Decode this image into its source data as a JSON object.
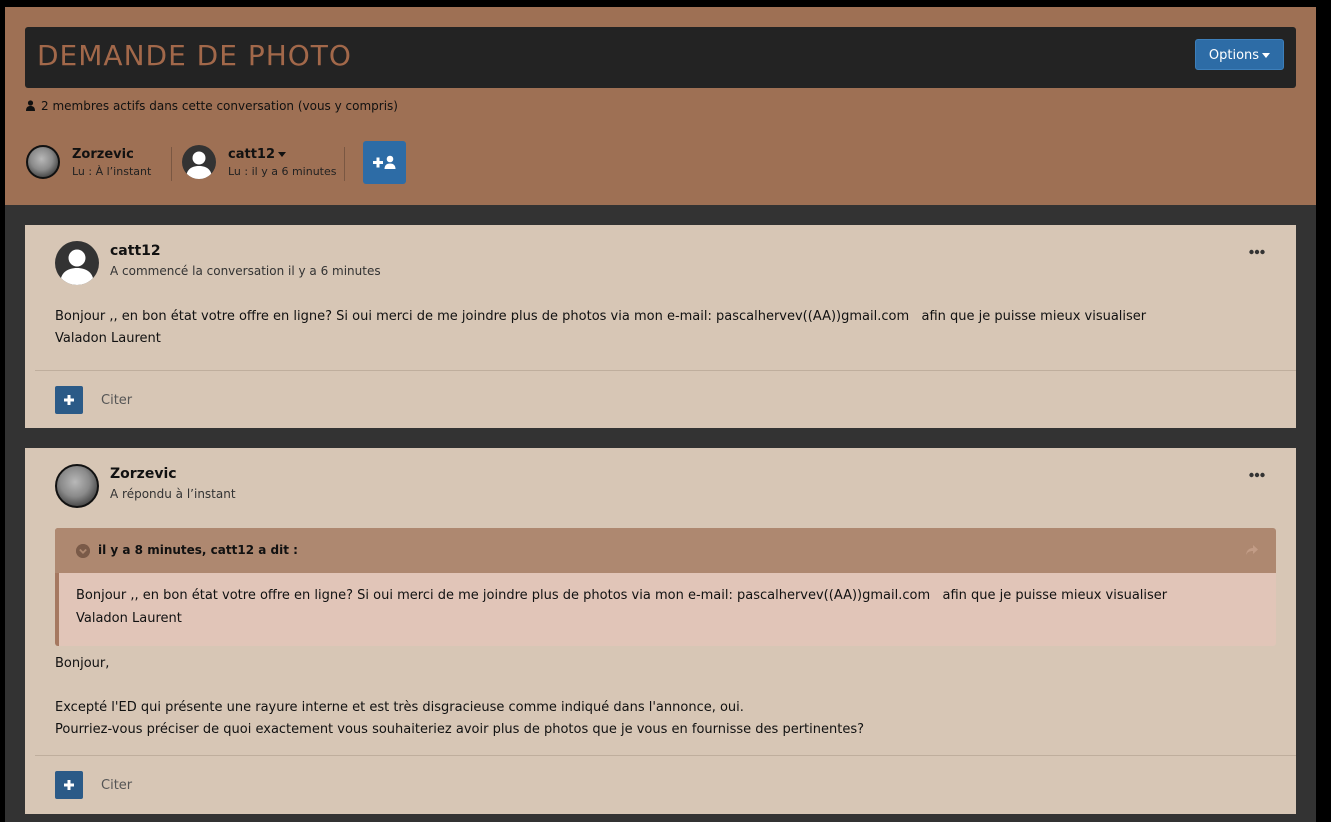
{
  "header": {
    "title": "DEMANDE DE PHOTO",
    "options_label": "Options",
    "members_text": "2 membres actifs dans cette conversation (vous y compris)"
  },
  "participants": [
    {
      "name": "Zorzevic",
      "read": "Lu : À l’instant",
      "avatar": "moon-avatar"
    },
    {
      "name": "catt12",
      "read": "Lu : il y a 6 minutes",
      "avatar": "default-avatar"
    }
  ],
  "posts": [
    {
      "author": "catt12",
      "subtitle": "A commencé la conversation il y a 6 minutes",
      "body": "Bonjour ,, en bon état votre offre en ligne? Si oui merci de me joindre plus de photos via mon e-mail: pascalhervev((AA))gmail.com   afin que je puisse mieux visualiser\nValadon Laurent",
      "cite_label": "Citer"
    },
    {
      "author": "Zorzevic",
      "subtitle": "A répondu à l’instant",
      "quote_header": "il y a 8 minutes, catt12 a dit :",
      "quote_body": "Bonjour ,, en bon état votre offre en ligne? Si oui merci de me joindre plus de photos via mon e-mail: pascalhervev((AA))gmail.com   afin que je puisse mieux visualiser\nValadon Laurent",
      "body": "Bonjour,\n\nExcepté l'ED qui présente une rayure interne et est très disgracieuse comme indiqué dans l'annonce, oui.\nPourriez-vous préciser de quoi exactement vous souhaiteriez avoir plus de photos que je vous en fournisse des pertinentes?",
      "cite_label": "Citer"
    }
  ],
  "colors": {
    "header_bg": "#9e7054",
    "title_color": "#a2684a",
    "accent_blue": "#2d6ca6",
    "post_bg": "#d7c6b5",
    "quote_bg": "#e1c5b8"
  }
}
